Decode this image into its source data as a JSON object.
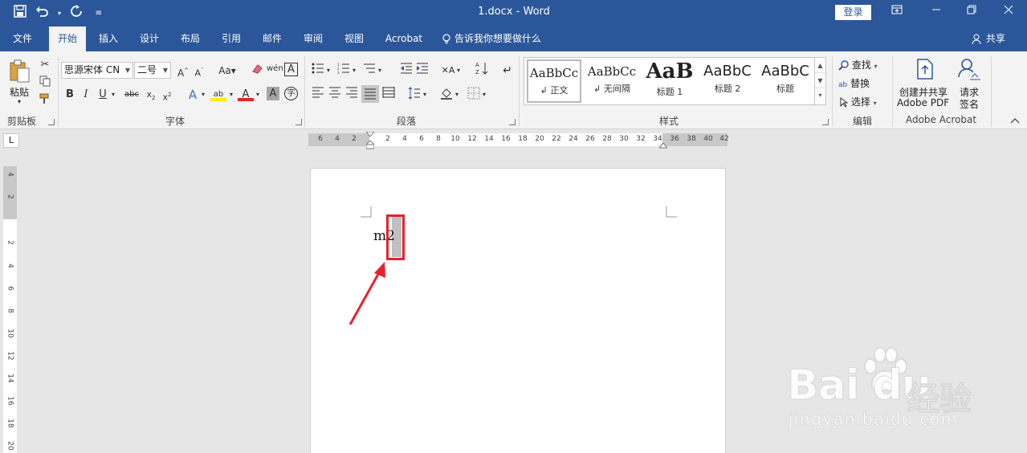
{
  "window": {
    "title": "1.docx  -  Word",
    "login_label": "登录",
    "share_label": "共享"
  },
  "qat": {
    "save_icon": "save-icon",
    "undo_icon": "undo-icon",
    "redo_icon": "redo-icon",
    "customize_icon": "customize-qat-icon"
  },
  "tabs": [
    {
      "label": "文件"
    },
    {
      "label": "开始"
    },
    {
      "label": "插入"
    },
    {
      "label": "设计"
    },
    {
      "label": "布局"
    },
    {
      "label": "引用"
    },
    {
      "label": "邮件"
    },
    {
      "label": "审阅"
    },
    {
      "label": "视图"
    },
    {
      "label": "Acrobat"
    }
  ],
  "tell_me": "告诉我你想要做什么",
  "ribbon": {
    "clipboard": {
      "paste_label": "粘贴",
      "group_label": "剪贴板"
    },
    "font": {
      "font_name": "思源宋体 CN",
      "font_size": "二号",
      "group_label": "字体"
    },
    "paragraph": {
      "group_label": "段落"
    },
    "styles": {
      "group_label": "样式",
      "tiles": [
        {
          "sample": "AaBbCc",
          "name": "正文"
        },
        {
          "sample": "AaBbCc",
          "name": "无间隔"
        },
        {
          "sample": "AaB",
          "name": "标题 1"
        },
        {
          "sample": "AaBbC",
          "name": "标题 2"
        },
        {
          "sample": "AaBbC",
          "name": "标题"
        }
      ]
    },
    "editing": {
      "find_label": "查找",
      "replace_label": "替换",
      "select_label": "选择",
      "group_label": "编辑"
    },
    "acrobat": {
      "create_pdf_line1": "创建并共享",
      "create_pdf_line2": "Adobe PDF",
      "request_sign_line1": "请求",
      "request_sign_line2": "签名",
      "group_label": "Adobe Acrobat"
    }
  },
  "hruler_numbers": [
    "6",
    "4",
    "2",
    "2",
    "4",
    "6",
    "8",
    "10",
    "12",
    "14",
    "16",
    "18",
    "20",
    "22",
    "24",
    "26",
    "28",
    "30",
    "32",
    "34",
    "36",
    "38",
    "40",
    "42"
  ],
  "vruler_numbers": [
    "4",
    "2",
    "2",
    "4",
    "6",
    "8",
    "10",
    "12",
    "14",
    "16",
    "18",
    "20"
  ],
  "tab_stop_glyph": "L",
  "document": {
    "text": "m2"
  },
  "watermark": {
    "logo": "Bai du",
    "cn": "经验",
    "url": "jingyan.baidu.com"
  },
  "colors": {
    "accent": "#2b579a",
    "highlight_box": "#e8212d"
  }
}
